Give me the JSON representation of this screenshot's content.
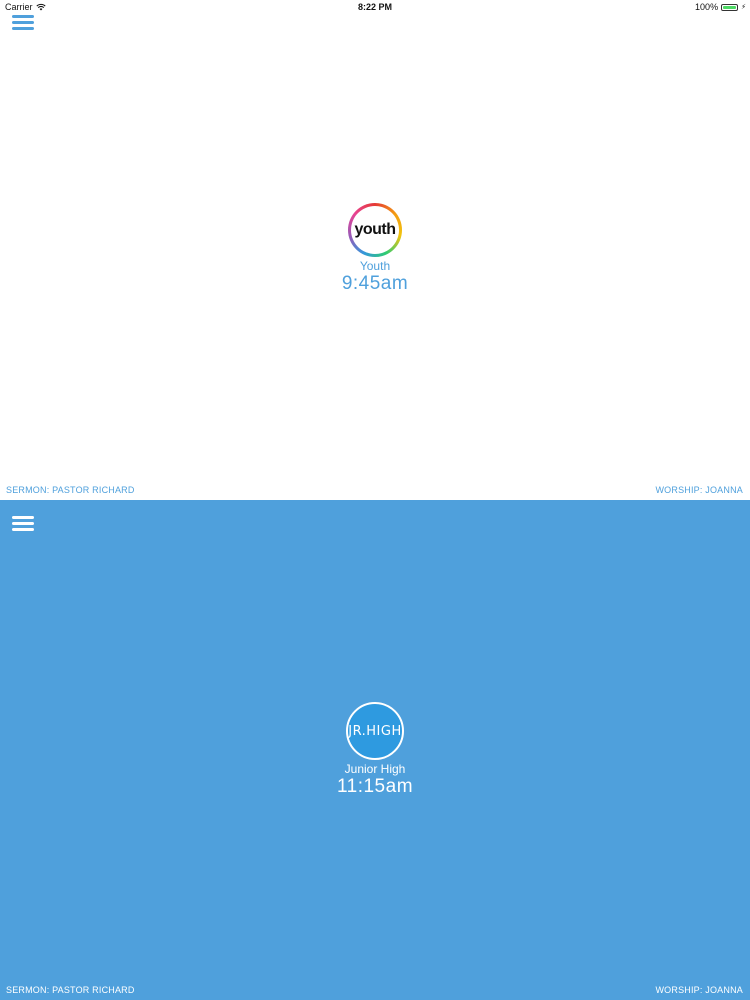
{
  "status_bar": {
    "carrier": "Carrier",
    "time": "8:22 PM",
    "battery": "100%"
  },
  "colors": {
    "accent": "#4fa0dc",
    "background_top": "#ffffff",
    "background_bottom": "#4fa0dc"
  },
  "services": [
    {
      "logo_text": "youth",
      "name": "Youth",
      "time": "9:45am",
      "sermon": "SERMON: PASTOR RICHARD",
      "worship": "WORSHIP: JOANNA"
    },
    {
      "logo_text": "JR.HIGH",
      "name": "Junior High",
      "time": "11:15am",
      "sermon": "SERMON: PASTOR RICHARD",
      "worship": "WORSHIP: JOANNA"
    }
  ]
}
